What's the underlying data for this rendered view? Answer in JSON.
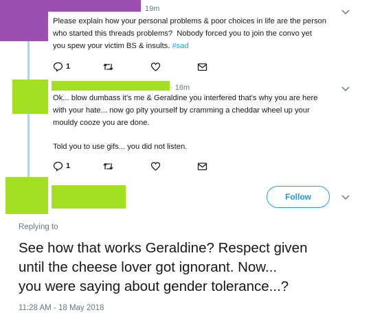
{
  "colors": {
    "redaction_purple": "#9b4fb0",
    "redaction_green": "#a3e022",
    "link_blue": "#1da1f2",
    "thread_line": "#aed4ec",
    "muted_text": "#657786"
  },
  "tweets": [
    {
      "time": "19m",
      "text": "Please explain how your personal problems & poor choices in life are the person\nwho started this threads problems?  Nobody forced you to join the convo yet\nyou spew your victim BS & insults. ",
      "hashtag": "#sad",
      "reply_count": "1",
      "icons": [
        "reply-icon",
        "retweet-icon",
        "like-icon",
        "message-icon"
      ]
    },
    {
      "time": "· 16m",
      "text": "Ok... blow dumbass it's me & Geraldine you interfered that's why you are here\nwith your hate... now go pity yourself by cramming a cheddar wheel up your\nmouldy cooze you are done.\n\nTold you to use gifs... you did not listen.",
      "reply_count": "1",
      "icons": [
        "reply-icon",
        "retweet-icon",
        "like-icon",
        "message-icon"
      ]
    }
  ],
  "main_tweet": {
    "follow_label": "Follow",
    "replying_to": "Replying to",
    "text": "See how that works Geraldine? Respect given\nuntil the cheese lover got ignorant. Now...\nyou were saying about gender tolerance...?",
    "timestamp": "11:28 AM - 18 May 2018"
  }
}
